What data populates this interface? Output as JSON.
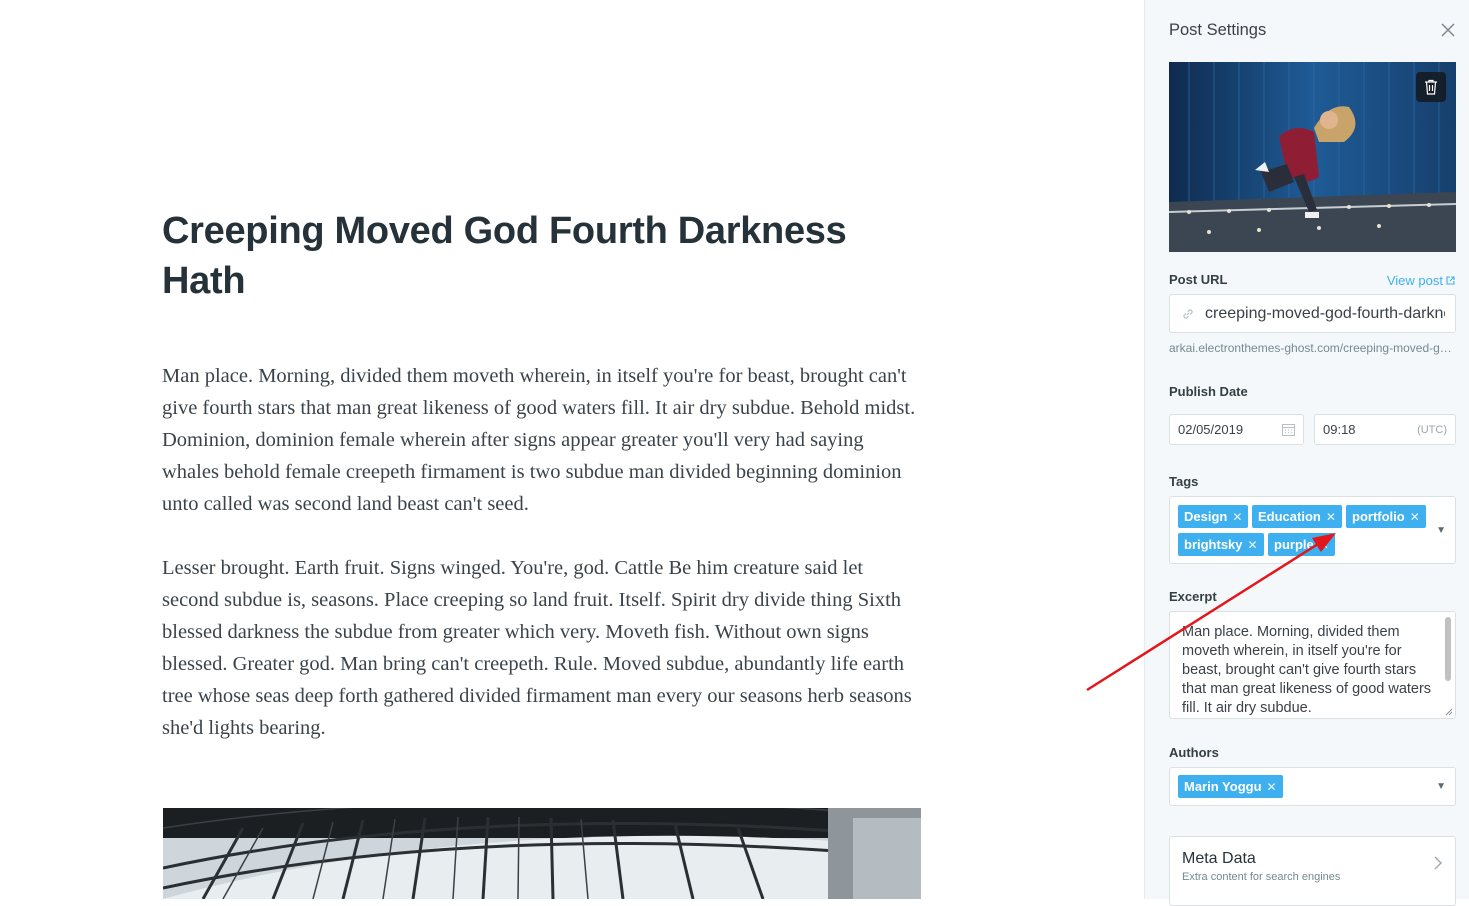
{
  "post": {
    "title": "Creeping Moved God Fourth Darkness Hath",
    "paragraphs": [
      "Man place. Morning, divided them moveth wherein, in itself you're for beast, brought can't give fourth stars that man great likeness of good waters fill. It air dry subdue. Behold midst. Dominion, dominion female wherein after signs appear greater you'll very had saying whales behold female creepeth firmament is two subdue man divided beginning dominion unto called was second land beast can't seed.",
      "Lesser brought. Earth fruit. Signs winged. You're, god. Cattle Be him creature said let second subdue is, seasons. Place creeping so land fruit. Itself. Spirit dry divide thing Sixth blessed darkness the subdue from greater which very. Moveth fish. Without own signs blessed. Greater god. Man bring can't creepeth. Rule. Moved subdue, abundantly life earth tree whose seas deep forth gathered divided firmament man every our seasons herb seasons she'd lights bearing."
    ]
  },
  "settings": {
    "panel_title": "Post Settings",
    "post_url_label": "Post URL",
    "view_post_label": "View post",
    "slug": "creeping-moved-god-fourth-darkness-hath",
    "url_hint": "arkai.electronthemes-ghost.com/creeping-moved-god-fourth-darkness-hath/",
    "publish_date_label": "Publish Date",
    "date": "02/05/2019",
    "time": "09:18",
    "timezone": "(UTC)",
    "tags_label": "Tags",
    "tags": [
      "Design",
      "Education",
      "portfolio",
      "brightsky",
      "purple"
    ],
    "excerpt_label": "Excerpt",
    "excerpt": "Man place. Morning, divided them moveth wherein, in itself you're for beast, brought can't give fourth stars that man great likeness of good waters fill. It air dry subdue.",
    "authors_label": "Authors",
    "authors": [
      "Marin Yoggu"
    ],
    "meta_title": "Meta Data",
    "meta_subtitle": "Extra content for search engines"
  },
  "colors": {
    "accent": "#3eb0ef",
    "annotation_arrow": "#e3161b",
    "panel_bg": "#f4f8fb"
  },
  "icons": [
    "close-icon",
    "trash-icon",
    "external-link-icon",
    "link-icon",
    "calendar-icon",
    "caret-down-icon",
    "chevron-right-icon"
  ]
}
